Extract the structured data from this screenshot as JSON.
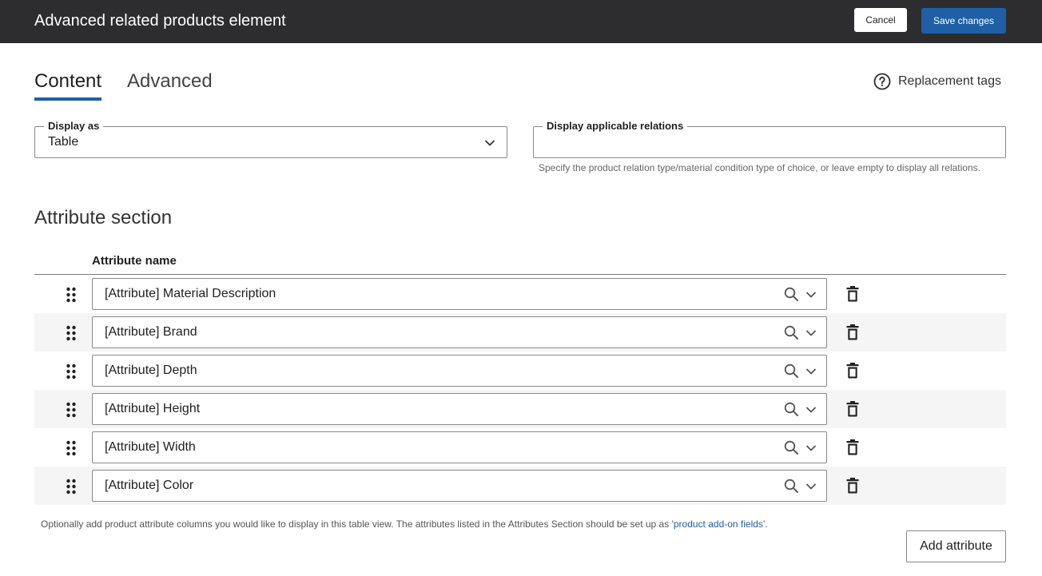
{
  "header": {
    "title": "Advanced related products element",
    "cancel_label": "Cancel",
    "save_label": "Save changes"
  },
  "tabs": [
    {
      "label": "Content",
      "active": true
    },
    {
      "label": "Advanced",
      "active": false
    }
  ],
  "replacement_tags_label": "Replacement tags",
  "display_as": {
    "legend": "Display as",
    "value": "Table"
  },
  "relations": {
    "legend": "Display applicable relations",
    "value": "",
    "help": "Specify the product relation type/material condition type of choice, or leave empty to display all relations."
  },
  "attribute_section": {
    "title": "Attribute section",
    "column_header": "Attribute name",
    "rows": [
      "[Attribute] Material Description",
      "[Attribute] Brand",
      "[Attribute] Depth",
      "[Attribute] Height",
      "[Attribute] Width",
      "[Attribute] Color"
    ]
  },
  "footnote": {
    "text_before": "Optionally add product attribute columns you would like to display in this table view. The attributes listed in the Attributes Section should be set up as '",
    "link": "product add-on fields",
    "text_after": "'."
  },
  "add_attribute_label": "Add attribute",
  "colors": {
    "header_bg": "#2d2d30",
    "accent": "#1e5fa6",
    "row_alt": "#f5f5f6"
  },
  "icons": {
    "help": "question-circle-icon",
    "chevron": "chevron-down-icon",
    "search": "search-icon",
    "drag": "drag-handle-icon",
    "delete": "trash-icon"
  }
}
